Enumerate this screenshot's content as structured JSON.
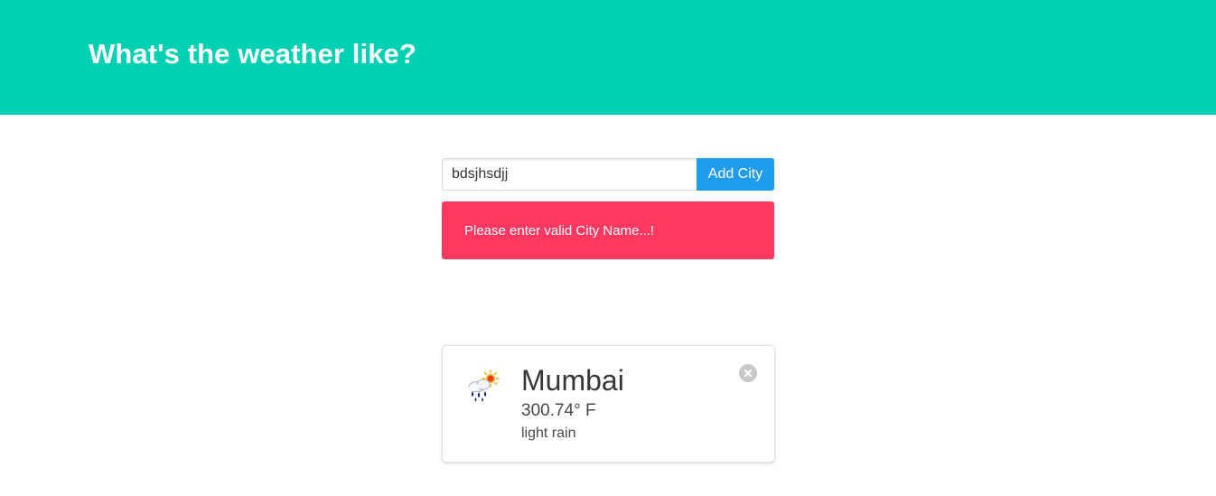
{
  "header": {
    "title": "What's the weather like?",
    "background_color": "#00d1b2"
  },
  "form": {
    "city_input_value": "bdsjhsdjj",
    "add_button_label": "Add City",
    "button_color": "#209cee"
  },
  "notification": {
    "message": "Please enter valid City Name...!",
    "color": "#ff3860"
  },
  "cards": [
    {
      "city": "Mumbai",
      "temperature": "300.74° F",
      "description": "light rain",
      "icon": "light-rain-icon"
    }
  ]
}
